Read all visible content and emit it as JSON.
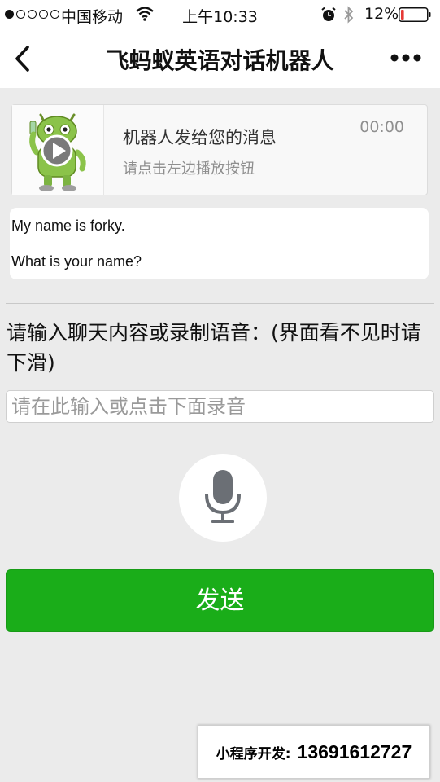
{
  "status_bar": {
    "carrier": "中国移动",
    "time": "上午10:33",
    "battery": "12%",
    "signal_bars_filled": 1,
    "signal_bars_total": 5,
    "battery_level": 0.12
  },
  "nav": {
    "title": "飞蚂蚁英语对话机器人"
  },
  "message_card": {
    "title": "机器人发给您的消息",
    "subtitle": "请点击左边播放按钮",
    "duration": "00:00"
  },
  "robot_text": {
    "lines": [
      "My name is forky.",
      "What is your name?"
    ]
  },
  "input_section": {
    "prompt": "请输入聊天内容或录制语音：(界面看不见时请下滑)",
    "placeholder": "请在此输入或点击下面录音",
    "value": ""
  },
  "send_label": "发送",
  "contact": {
    "label": "小程序开发:",
    "phone": "13691612727"
  },
  "colors": {
    "accent_green": "#1aad19",
    "battery_low": "#e53935",
    "robot_green": "#8bc34a"
  }
}
